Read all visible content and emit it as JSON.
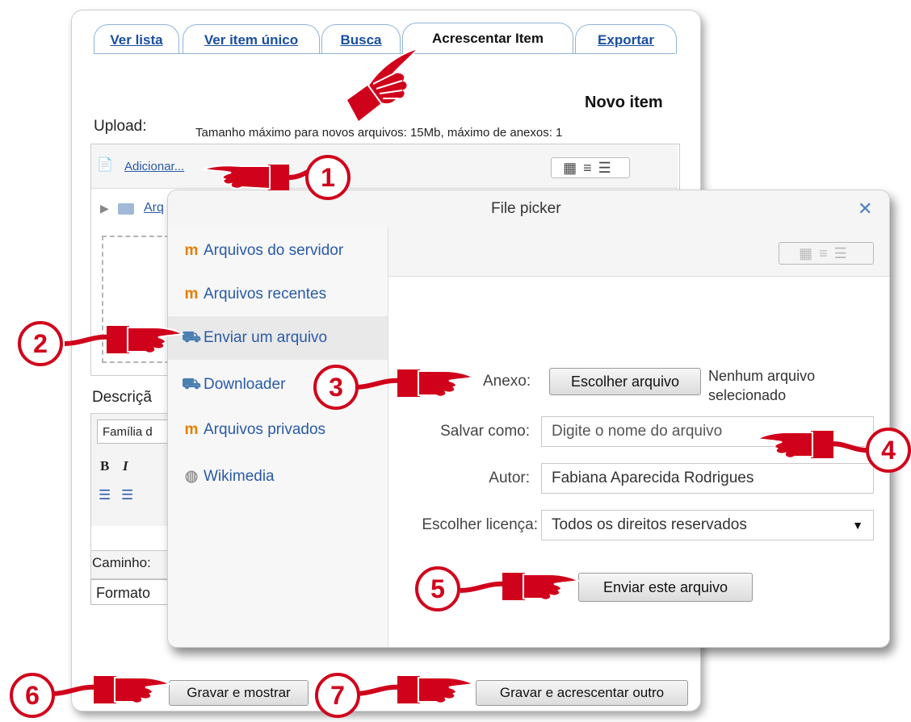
{
  "tabs": [
    "Ver lista",
    "Ver item único",
    "Busca",
    "Acrescentar Item",
    "Exportar"
  ],
  "page": {
    "heading": "Novo item",
    "upload_label": "Upload:",
    "upload_limits": "Tamanho máximo para novos arquivos: 15Mb, máximo de anexos: 1",
    "add_link": "Adicionar...",
    "folder_link": "Arq",
    "description_label": "Descriçã",
    "font_family_select": "Família d",
    "path_label": "Caminho:",
    "format_select": "Formato",
    "save_show_button": "Gravar e mostrar",
    "save_add_button": "Gravar e acrescentar outro"
  },
  "modal": {
    "title": "File picker",
    "close": "✕",
    "repositories": [
      {
        "label": "Arquivos do servidor",
        "icon": "moodle-icon"
      },
      {
        "label": "Arquivos recentes",
        "icon": "moodle-icon"
      },
      {
        "label": "Enviar um arquivo",
        "icon": "upload-icon"
      },
      {
        "label": "Downloader",
        "icon": "upload-icon"
      },
      {
        "label": "Arquivos privados",
        "icon": "moodle-icon"
      },
      {
        "label": "Wikimedia",
        "icon": "wikimedia-icon"
      }
    ],
    "attachment_label": "Anexo:",
    "choose_file_button": "Escolher arquivo",
    "no_file_text_1": "Nenhum arquivo",
    "no_file_text_2": "selecionado",
    "save_as_label": "Salvar como:",
    "save_as_placeholder": "Digite o nome do arquivo",
    "author_label": "Autor:",
    "author_value": "Fabiana Aparecida Rodrigues",
    "license_label": "Escolher licença:",
    "license_value": "Todos os direitos reservados",
    "submit_button": "Enviar este arquivo"
  },
  "callouts": [
    "1",
    "2",
    "3",
    "4",
    "5",
    "6",
    "7"
  ],
  "colors": {
    "accent_red": "#d0021b",
    "link_blue": "#2a5aa8",
    "tab_border": "#8fb3d9"
  }
}
